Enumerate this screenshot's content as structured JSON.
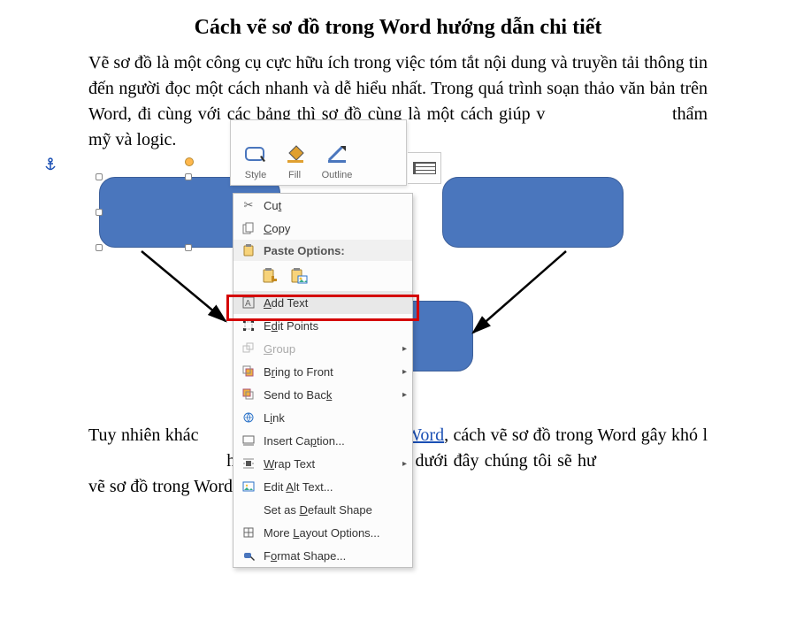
{
  "article": {
    "title": "Cách vẽ sơ đồ trong Word hướng dẫn chi tiết",
    "p1_a": "Vẽ sơ đồ là một công cụ cực hữu ích trong việc tóm tắt nội dung và truyền tải thông tin đến người đọc một cách nhanh và dễ hiểu nhất. Trong quá trình soạn thảo văn bản trên Word, đi cùng với các bảng thì sơ đồ cùng là một cách giúp v",
    "p1_b": "thẩm mỹ và logic.",
    "p2_a": "Tuy nhiên khác",
    "p2_link": "ng trong Word",
    "p2_b": ", cách vẽ sơ đồ trong Word gây khó l",
    "p2_c": "hơn nhiều. Trong bài viết dưới đây chúng tôi sẽ hư",
    "p2_d": "vẽ sơ đồ trong Word."
  },
  "miniToolbar": {
    "items": [
      {
        "label": "Style"
      },
      {
        "label": "Fill"
      },
      {
        "label": "Outline"
      }
    ]
  },
  "contextMenu": {
    "cut": "Cut",
    "copy": "Copy",
    "pasteHeader": "Paste Options:",
    "addText": "Add Text",
    "editPoints": "Edit Points",
    "group": "Group",
    "bringFront": "Bring to Front",
    "sendBack": "Send to Back",
    "link": "Link",
    "insertCaption": "Insert Caption...",
    "wrapText": "Wrap Text",
    "editAlt": "Edit Alt Text...",
    "setDefault": "Set as Default Shape",
    "moreLayout": "More Layout Options...",
    "formatShape": "Format Shape..."
  },
  "shapes": {
    "fill": "#4a76bd"
  }
}
